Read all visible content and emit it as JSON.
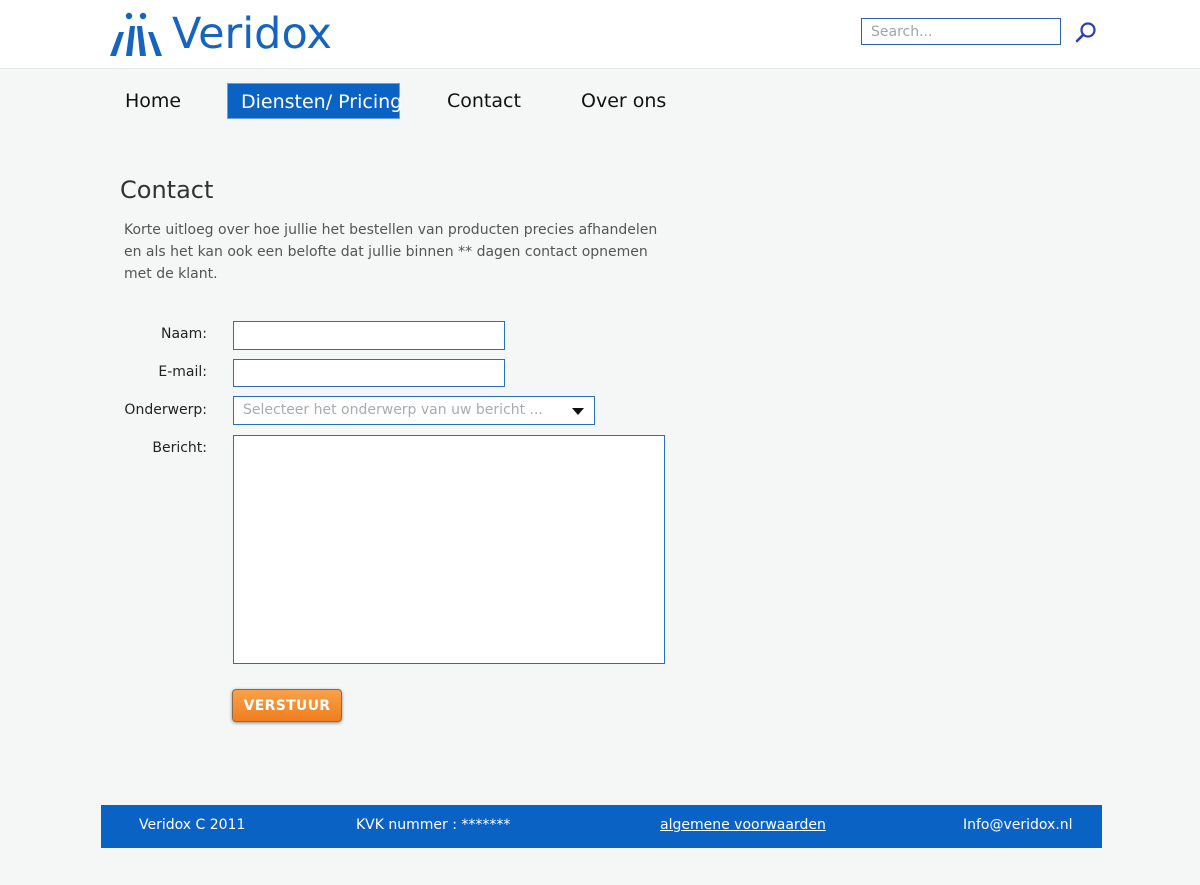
{
  "brand": {
    "name": "Veridox"
  },
  "search": {
    "placeholder": "Search..."
  },
  "nav": {
    "items": [
      {
        "label": "Home",
        "active": false
      },
      {
        "label": "Diensten/ Pricing",
        "active": true
      },
      {
        "label": "Contact",
        "active": false
      },
      {
        "label": "Over ons",
        "active": false
      }
    ]
  },
  "main": {
    "title": "Contact",
    "intro": "Korte uitloeg over hoe jullie het bestellen van producten precies afhandelen en als het kan ook een belofte dat jullie binnen ** dagen contact opnemen met de klant."
  },
  "form": {
    "name_label": "Naam:",
    "name_value": "",
    "email_label": "E-mail:",
    "email_value": "",
    "subject_label": "Onderwerp:",
    "subject_placeholder": "Selecteer het onderwerp van uw bericht ...",
    "message_label": "Bericht:",
    "message_value": "",
    "submit_label": "VERSTUUR"
  },
  "footer": {
    "copyright": "Veridox C 2011",
    "kvk": "KVK nummer : *******",
    "terms_link": "algemene voorwaarden",
    "email": "Info@veridox.nl"
  },
  "colors": {
    "brand_blue": "#1565c0",
    "nav_active": "#0a62c5",
    "footer_bg": "#0a62c5",
    "submit_orange": "#f28a2a",
    "page_bg": "#f5f7f6"
  },
  "icons": {
    "logo": "veridox-logo-icon",
    "search": "search-icon",
    "dropdown": "chevron-down-icon"
  }
}
